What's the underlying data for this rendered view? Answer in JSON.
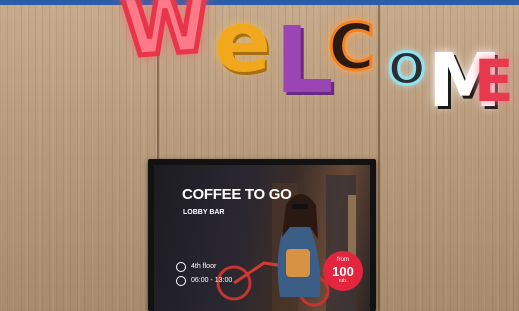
{
  "sign": {
    "letters": [
      {
        "char": "W",
        "color": "#e8354a",
        "glow": "#ff6b7b"
      },
      {
        "char": "e",
        "color": "#f2a81d",
        "glow": "#ffcc55"
      },
      {
        "char": "L",
        "color": "#9b45b5",
        "glow": "#c97ce0"
      },
      {
        "char": "C",
        "color": "#f58220",
        "glow": "#ffb060"
      },
      {
        "char": "O",
        "color": "#6fd0e0",
        "glow": "#b7f1ff"
      },
      {
        "char": "M",
        "color": "#ffffff",
        "glow": "#ffffff"
      },
      {
        "char": "E",
        "color": "#e83a4e",
        "glow": "#ff7d8a"
      }
    ]
  },
  "ad": {
    "title": "COFFEE TO GO",
    "subtitle": "LOBBY BAR",
    "floor": "4th floor",
    "hours": "06:00 - 13:00",
    "badge": {
      "from": "from",
      "price": "100",
      "unit": "rub.",
      "color": "#e3263d"
    }
  }
}
